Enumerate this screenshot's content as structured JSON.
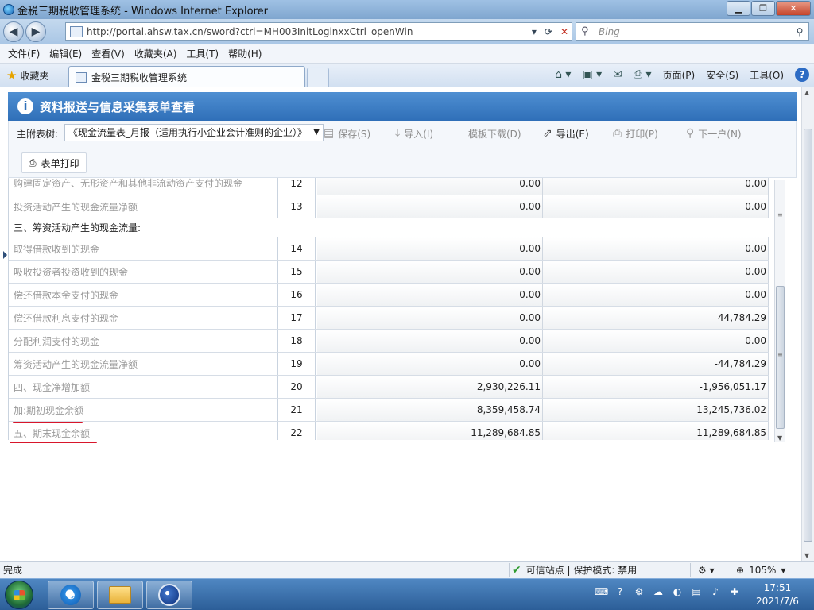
{
  "window": {
    "title": "金税三期税收管理系统 - Windows Internet Explorer",
    "url": "http://portal.ahsw.tax.cn/sword?ctrl=MH003InitLoginxxCtrl_openWin",
    "search_placeholder": "Bing",
    "menu": [
      "文件(F)",
      "编辑(E)",
      "查看(V)",
      "收藏夹(A)",
      "工具(T)",
      "帮助(H)"
    ],
    "favorites_label": "收藏夹",
    "tab_title": "金税三期税收管理系统",
    "command_bar": [
      "页面(P)",
      "安全(S)",
      "工具(O)"
    ]
  },
  "panel": {
    "title": "资料报送与信息采集表单查看",
    "main_table_label": "主附表树:",
    "selected_table": "《现金流量表_月报（适用执行小企业会计准则的企业）》",
    "buttons": {
      "save": "保存(S)",
      "import": "导入(I)",
      "template_download": "模板下载(D)",
      "export": "导出(E)",
      "print": "打印(P)",
      "next": "下一户(N)",
      "form_print": "表单打印"
    }
  },
  "table": {
    "rows": [
      {
        "name": "购建固定资产、无形资产和其他非流动资产支付的现金",
        "no": "12",
        "v1": "0.00",
        "v2": "0.00"
      },
      {
        "name": "投资活动产生的现金流量净额",
        "no": "13",
        "v1": "0.00",
        "v2": "0.00"
      },
      {
        "name": "三、筹资活动产生的现金流量:",
        "section": true
      },
      {
        "name": "取得借款收到的现金",
        "no": "14",
        "v1": "0.00",
        "v2": "0.00"
      },
      {
        "name": "吸收投资者投资收到的现金",
        "no": "15",
        "v1": "0.00",
        "v2": "0.00"
      },
      {
        "name": "偿还借款本金支付的现金",
        "no": "16",
        "v1": "0.00",
        "v2": "0.00"
      },
      {
        "name": "偿还借款利息支付的现金",
        "no": "17",
        "v1": "0.00",
        "v2": "44,784.29"
      },
      {
        "name": "分配利润支付的现金",
        "no": "18",
        "v1": "0.00",
        "v2": "0.00"
      },
      {
        "name": "筹资活动产生的现金流量净额",
        "no": "19",
        "v1": "0.00",
        "v2": "-44,784.29"
      },
      {
        "name": "四、现金净增加额",
        "no": "20",
        "v1": "2,930,226.11",
        "v2": "-1,956,051.17"
      },
      {
        "name": "加:期初现金余额",
        "no": "21",
        "v1": "8,359,458.74",
        "v2": "13,245,736.02"
      },
      {
        "name": "五、期末现金余额",
        "no": "22",
        "v1": "11,289,684.85",
        "v2": "11,289,684.85"
      }
    ]
  },
  "status": {
    "left": "完成",
    "trust": "可信站点 | 保护模式: 禁用",
    "zoom": "105%"
  },
  "taskbar": {
    "time": "17:51",
    "date": "2021/7/6"
  },
  "colors": {
    "panel_header": "#2f6fb8",
    "annotation_red": "#d8162b"
  }
}
